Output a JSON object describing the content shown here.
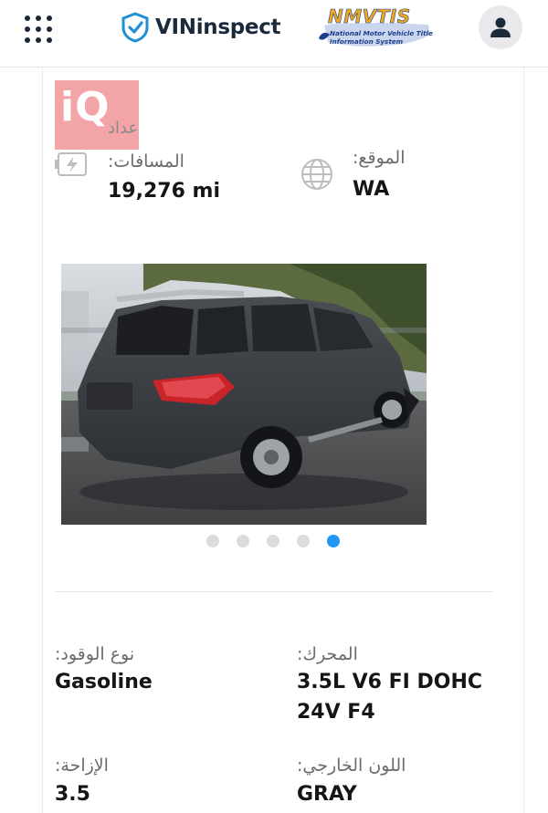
{
  "header": {
    "brand_name": "VINinspect",
    "nmvtis": {
      "title": "NMVTIS",
      "subtitle": "National Motor Vehicle Title Information System"
    },
    "icons": {
      "menu": "grid-menu-icon",
      "brand": "shield-check-icon",
      "account": "user-icon"
    }
  },
  "watermark": {
    "text": "iQ",
    "color": "#ef8a8e"
  },
  "summary": {
    "odometer_partial": "عداد",
    "mileage_label": ":المسافات",
    "mileage_value": "19,276 mi",
    "location_label": ":الموقع",
    "location_value": "WA"
  },
  "gallery": {
    "total": 5,
    "active_index": 4,
    "active_color": "#2196f3"
  },
  "specs": {
    "fuel_label": ":نوع الوقود",
    "fuel_value": "Gasoline",
    "engine_label": ":المحرك",
    "engine_value_line1": "3.5L V6 FI DOHC",
    "engine_value_line2": "24V F4",
    "displacement_label": ":الإزاحة",
    "displacement_value": "3.5",
    "color_label": ":اللون الخارجي",
    "color_value": "GRAY"
  }
}
